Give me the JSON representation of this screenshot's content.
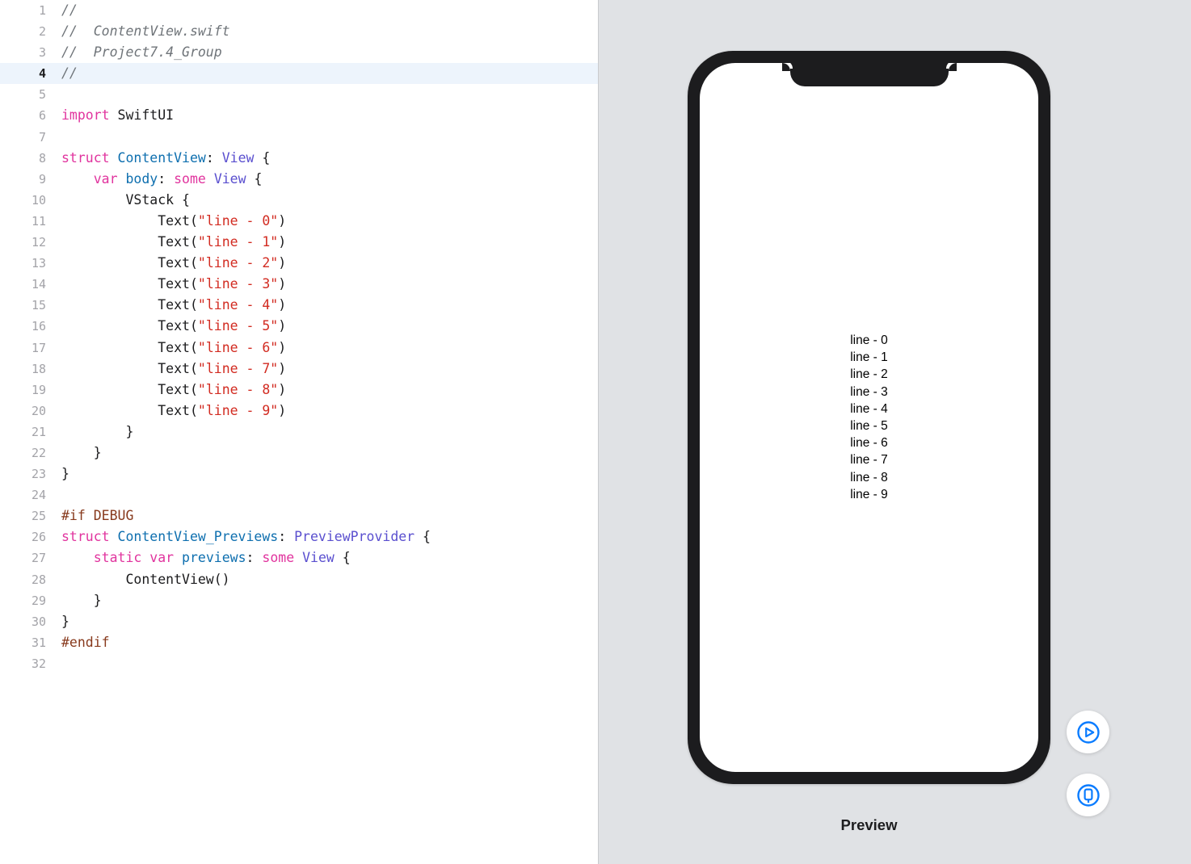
{
  "editor": {
    "filename": "ContentView.swift",
    "project": "Project7.4_Group",
    "highlighted_line": 4,
    "lines": [
      {
        "num": "1",
        "tokens": [
          {
            "c": "t-comment",
            "t": "//"
          }
        ]
      },
      {
        "num": "2",
        "tokens": [
          {
            "c": "t-comment",
            "t": "//  ContentView.swift"
          }
        ]
      },
      {
        "num": "3",
        "tokens": [
          {
            "c": "t-comment",
            "t": "//  Project7.4_Group"
          }
        ]
      },
      {
        "num": "4",
        "tokens": [
          {
            "c": "t-comment",
            "t": "//"
          }
        ]
      },
      {
        "num": "5",
        "tokens": []
      },
      {
        "num": "6",
        "tokens": [
          {
            "c": "t-kw",
            "t": "import"
          },
          {
            "c": "t-plain",
            "t": " SwiftUI"
          }
        ]
      },
      {
        "num": "7",
        "tokens": []
      },
      {
        "num": "8",
        "tokens": [
          {
            "c": "t-kw",
            "t": "struct"
          },
          {
            "c": "t-plain",
            "t": " "
          },
          {
            "c": "t-type",
            "t": "ContentView"
          },
          {
            "c": "t-plain",
            "t": ": "
          },
          {
            "c": "t-proto",
            "t": "View"
          },
          {
            "c": "t-plain",
            "t": " {"
          }
        ]
      },
      {
        "num": "9",
        "tokens": [
          {
            "c": "t-plain",
            "t": "    "
          },
          {
            "c": "t-kw",
            "t": "var"
          },
          {
            "c": "t-plain",
            "t": " "
          },
          {
            "c": "t-prop",
            "t": "body"
          },
          {
            "c": "t-plain",
            "t": ": "
          },
          {
            "c": "t-kw",
            "t": "some"
          },
          {
            "c": "t-plain",
            "t": " "
          },
          {
            "c": "t-proto",
            "t": "View"
          },
          {
            "c": "t-plain",
            "t": " {"
          }
        ]
      },
      {
        "num": "10",
        "tokens": [
          {
            "c": "t-plain",
            "t": "        VStack {"
          }
        ]
      },
      {
        "num": "11",
        "tokens": [
          {
            "c": "t-plain",
            "t": "            Text("
          },
          {
            "c": "t-str",
            "t": "\"line - 0\""
          },
          {
            "c": "t-plain",
            "t": ")"
          }
        ]
      },
      {
        "num": "12",
        "tokens": [
          {
            "c": "t-plain",
            "t": "            Text("
          },
          {
            "c": "t-str",
            "t": "\"line - 1\""
          },
          {
            "c": "t-plain",
            "t": ")"
          }
        ]
      },
      {
        "num": "13",
        "tokens": [
          {
            "c": "t-plain",
            "t": "            Text("
          },
          {
            "c": "t-str",
            "t": "\"line - 2\""
          },
          {
            "c": "t-plain",
            "t": ")"
          }
        ]
      },
      {
        "num": "14",
        "tokens": [
          {
            "c": "t-plain",
            "t": "            Text("
          },
          {
            "c": "t-str",
            "t": "\"line - 3\""
          },
          {
            "c": "t-plain",
            "t": ")"
          }
        ]
      },
      {
        "num": "15",
        "tokens": [
          {
            "c": "t-plain",
            "t": "            Text("
          },
          {
            "c": "t-str",
            "t": "\"line - 4\""
          },
          {
            "c": "t-plain",
            "t": ")"
          }
        ]
      },
      {
        "num": "16",
        "tokens": [
          {
            "c": "t-plain",
            "t": "            Text("
          },
          {
            "c": "t-str",
            "t": "\"line - 5\""
          },
          {
            "c": "t-plain",
            "t": ")"
          }
        ]
      },
      {
        "num": "17",
        "tokens": [
          {
            "c": "t-plain",
            "t": "            Text("
          },
          {
            "c": "t-str",
            "t": "\"line - 6\""
          },
          {
            "c": "t-plain",
            "t": ")"
          }
        ]
      },
      {
        "num": "18",
        "tokens": [
          {
            "c": "t-plain",
            "t": "            Text("
          },
          {
            "c": "t-str",
            "t": "\"line - 7\""
          },
          {
            "c": "t-plain",
            "t": ")"
          }
        ]
      },
      {
        "num": "19",
        "tokens": [
          {
            "c": "t-plain",
            "t": "            Text("
          },
          {
            "c": "t-str",
            "t": "\"line - 8\""
          },
          {
            "c": "t-plain",
            "t": ")"
          }
        ]
      },
      {
        "num": "20",
        "tokens": [
          {
            "c": "t-plain",
            "t": "            Text("
          },
          {
            "c": "t-str",
            "t": "\"line - 9\""
          },
          {
            "c": "t-plain",
            "t": ")"
          }
        ]
      },
      {
        "num": "21",
        "tokens": [
          {
            "c": "t-plain",
            "t": "        }"
          }
        ]
      },
      {
        "num": "22",
        "tokens": [
          {
            "c": "t-plain",
            "t": "    }"
          }
        ]
      },
      {
        "num": "23",
        "tokens": [
          {
            "c": "t-plain",
            "t": "}"
          }
        ]
      },
      {
        "num": "24",
        "tokens": []
      },
      {
        "num": "25",
        "tokens": [
          {
            "c": "t-pre",
            "t": "#if DEBUG"
          }
        ]
      },
      {
        "num": "26",
        "tokens": [
          {
            "c": "t-kw",
            "t": "struct"
          },
          {
            "c": "t-plain",
            "t": " "
          },
          {
            "c": "t-type",
            "t": "ContentView_Previews"
          },
          {
            "c": "t-plain",
            "t": ": "
          },
          {
            "c": "t-proto",
            "t": "PreviewProvider"
          },
          {
            "c": "t-plain",
            "t": " {"
          }
        ]
      },
      {
        "num": "27",
        "tokens": [
          {
            "c": "t-plain",
            "t": "    "
          },
          {
            "c": "t-kw",
            "t": "static"
          },
          {
            "c": "t-plain",
            "t": " "
          },
          {
            "c": "t-kw",
            "t": "var"
          },
          {
            "c": "t-plain",
            "t": " "
          },
          {
            "c": "t-prop",
            "t": "previews"
          },
          {
            "c": "t-plain",
            "t": ": "
          },
          {
            "c": "t-kw",
            "t": "some"
          },
          {
            "c": "t-plain",
            "t": " "
          },
          {
            "c": "t-proto",
            "t": "View"
          },
          {
            "c": "t-plain",
            "t": " {"
          }
        ]
      },
      {
        "num": "28",
        "tokens": [
          {
            "c": "t-plain",
            "t": "        ContentView()"
          }
        ]
      },
      {
        "num": "29",
        "tokens": [
          {
            "c": "t-plain",
            "t": "    }"
          }
        ]
      },
      {
        "num": "30",
        "tokens": [
          {
            "c": "t-plain",
            "t": "}"
          }
        ]
      },
      {
        "num": "31",
        "tokens": [
          {
            "c": "t-pre",
            "t": "#endif"
          }
        ]
      },
      {
        "num": "32",
        "tokens": []
      }
    ]
  },
  "preview": {
    "label": "Preview",
    "device_text_lines": [
      "line - 0",
      "line - 1",
      "line - 2",
      "line - 3",
      "line - 4",
      "line - 5",
      "line - 6",
      "line - 7",
      "line - 8",
      "line - 9"
    ],
    "controls": [
      {
        "name": "live-preview-button",
        "icon": "play-circle-icon"
      },
      {
        "name": "device-settings-button",
        "icon": "device-circle-icon"
      }
    ]
  },
  "colors": {
    "accent_blue": "#0A7CFF",
    "preview_background": "#E0E2E5",
    "device_bezel": "#1C1C1E",
    "highlight_line": "#EDF4FC",
    "keyword": "#E1349E",
    "type": "#0E6FAF",
    "protocol": "#5A4FCF",
    "string": "#D22B21",
    "comment": "#6F7479",
    "preprocessor": "#87391C"
  }
}
